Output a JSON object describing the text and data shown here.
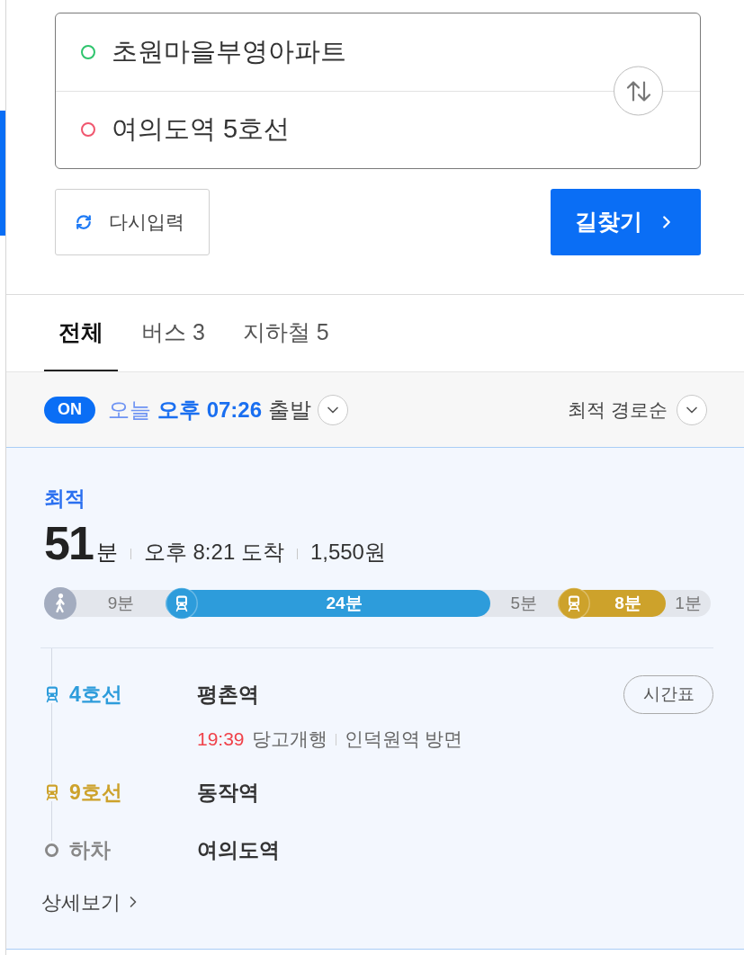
{
  "route_input": {
    "points": [
      {
        "value": "초원마을부영아파트",
        "color": "#2ec46d"
      },
      {
        "value": "여의도역 5호선",
        "color": "#f0566e"
      }
    ]
  },
  "buttons": {
    "reset": "다시입력",
    "search": "길찾기"
  },
  "tabs": [
    {
      "label": "전체",
      "selected": true
    },
    {
      "label": "버스 3",
      "selected": false
    },
    {
      "label": "지하철 5",
      "selected": false
    }
  ],
  "filter": {
    "badge": "ON",
    "day": "오늘",
    "time": "오후 07:26",
    "mode": "출발",
    "sort": "최적 경로순"
  },
  "route": {
    "tag": "최적",
    "duration": "51",
    "duration_unit": "분",
    "arrival": "오후 8:21 도착",
    "fare": "1,550원",
    "segments": [
      {
        "kind": "walk",
        "icon": true,
        "label": "9분"
      },
      {
        "kind": "subway",
        "label": "24분",
        "color": "#2d9cdb"
      },
      {
        "kind": "walk",
        "icon": false,
        "label": "5분"
      },
      {
        "kind": "subway",
        "label": "8분",
        "color": "#cda22b"
      },
      {
        "kind": "walk",
        "icon": false,
        "label": "1분"
      }
    ],
    "steps": [
      {
        "kind": "board",
        "line": "4호선",
        "color": "#2d9cdb",
        "station": "평촌역",
        "timetable": "시간표",
        "departure": "19:39",
        "destination": "당고개행",
        "direction": "인덕원역 방면"
      },
      {
        "kind": "board",
        "line": "9호선",
        "color": "#cda22b",
        "station": "동작역"
      },
      {
        "kind": "alight",
        "line": "하차",
        "color": "#888888",
        "station": "여의도역"
      }
    ],
    "details_link": "상세보기"
  }
}
